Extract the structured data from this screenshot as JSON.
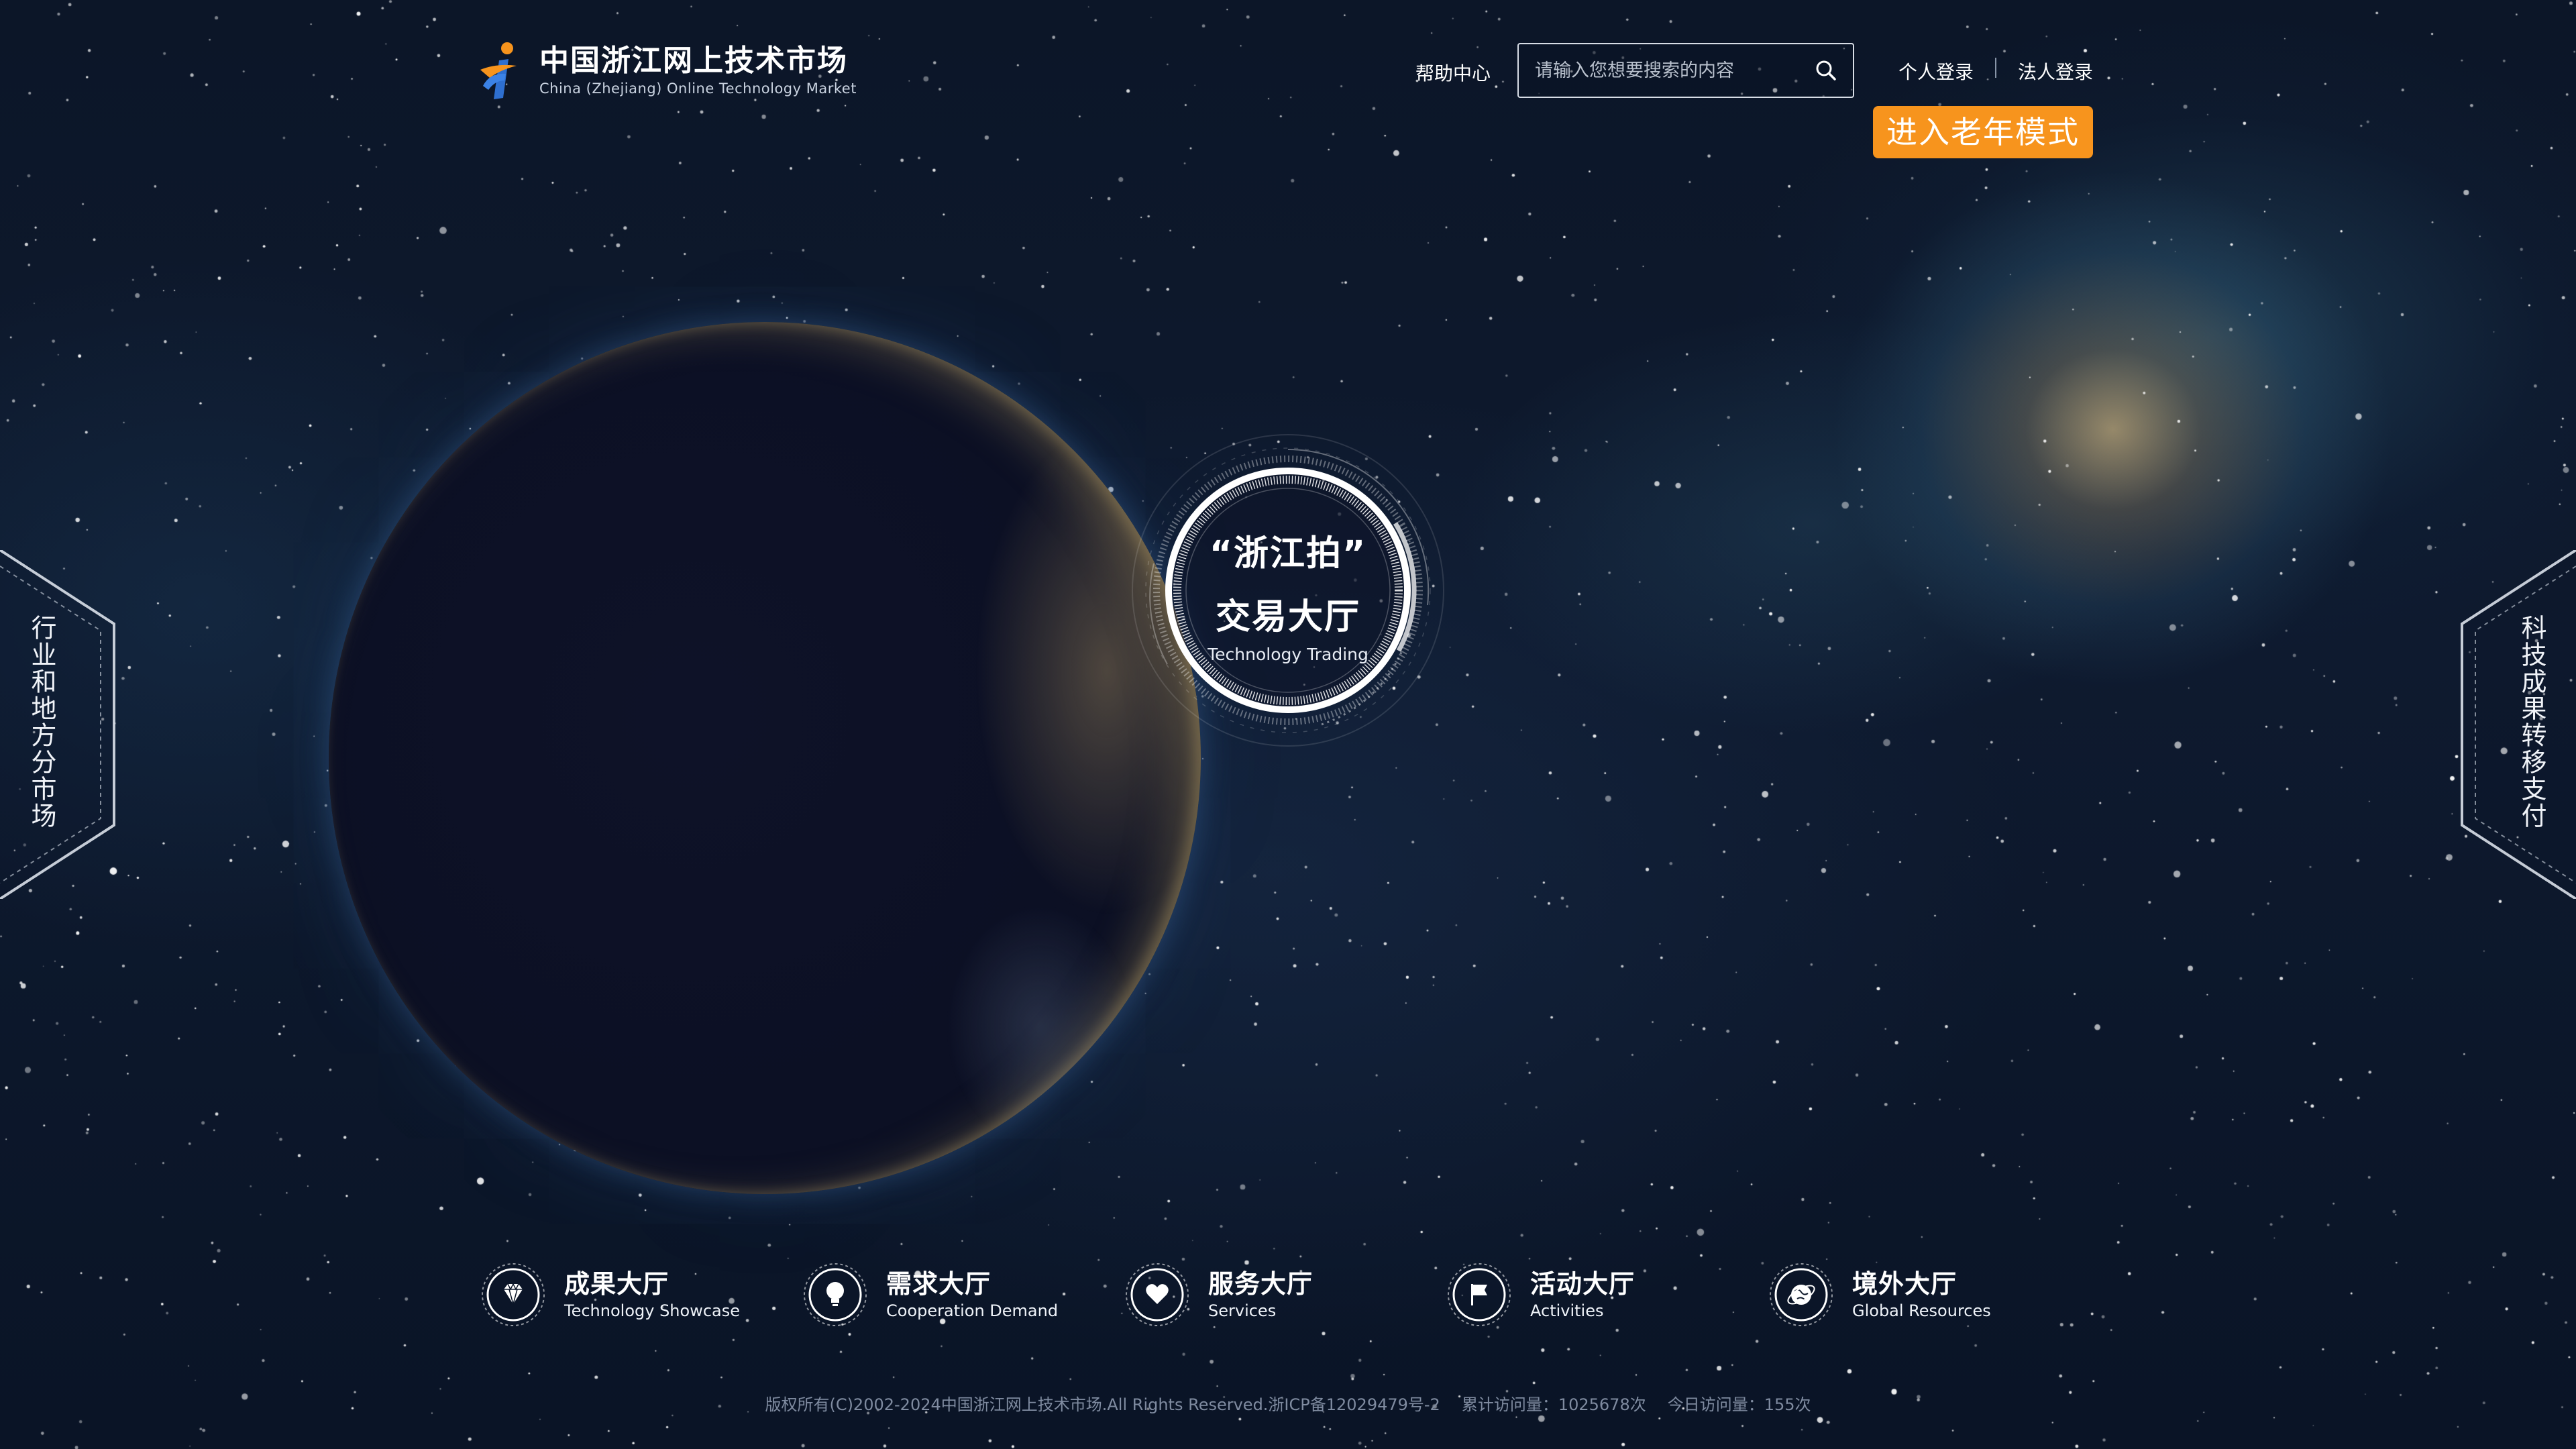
{
  "header": {
    "logo_title": "中国浙江网上技术市场",
    "logo_subtitle": "China (Zhejiang) Online Technology Market",
    "help_label": "帮助中心",
    "search_placeholder": "请输入您想要搜索的内容",
    "login_personal": "个人登录",
    "login_legal": "法人登录",
    "elder_mode": "进入老年模式"
  },
  "center": {
    "line1": "“浙江拍”",
    "line2": "交易大厅",
    "line3": "Technology Trading"
  },
  "side": {
    "left_label": "行业和地方分市场",
    "right_label": "科技成果转移支付"
  },
  "nav": [
    {
      "title": "成果大厅",
      "subtitle": "Technology Showcase",
      "icon": "diamond-icon"
    },
    {
      "title": "需求大厅",
      "subtitle": "Cooperation Demand",
      "icon": "lightbulb-icon"
    },
    {
      "title": "服务大厅",
      "subtitle": "Services",
      "icon": "heart-icon"
    },
    {
      "title": "活动大厅",
      "subtitle": "Activities",
      "icon": "flag-icon"
    },
    {
      "title": "境外大厅",
      "subtitle": "Global Resources",
      "icon": "globe-icon"
    }
  ],
  "footer": {
    "copyright": "版权所有(C)2002-2024中国浙江网上技术市场.All Rights Reserved.浙ICP备12029479号-2",
    "total_visits": "累计访问量：1025678次",
    "today_visits": "今日访问量：155次"
  },
  "colors": {
    "accent": "#f7941d",
    "background": "#0c1628"
  }
}
